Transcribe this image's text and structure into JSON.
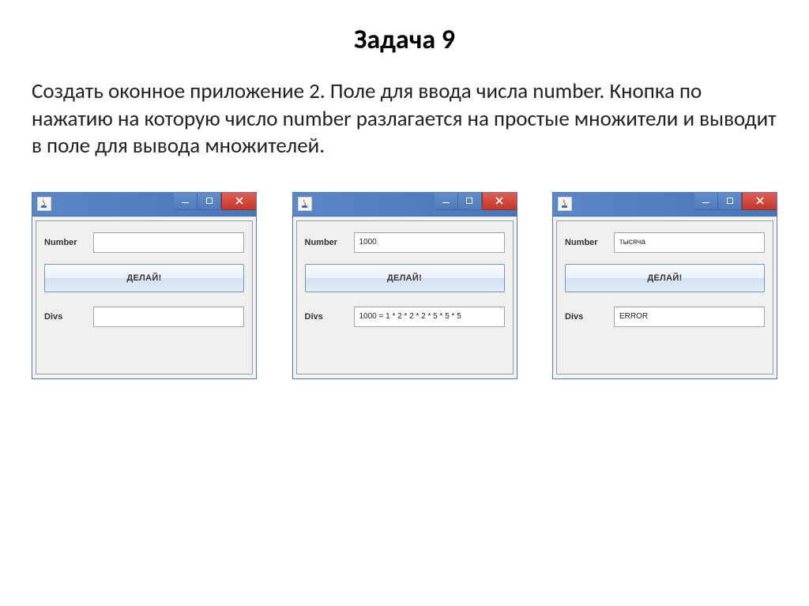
{
  "title": "Задача 9",
  "description": "Создать оконное приложение 2. Поле для ввода числа number. Кнопка по нажатию на которую число number разлагается на простые множители и выводит в поле для вывода множителей.",
  "labels": {
    "number": "Number",
    "divs": "Divs",
    "action": "ДЕЛАЙ!"
  },
  "icons": {
    "app": "java-cup-icon",
    "minimize": "minimize-icon",
    "maximize": "maximize-icon",
    "close": "close-icon"
  },
  "windows": [
    {
      "number_value": "",
      "divs_value": ""
    },
    {
      "number_value": "1000",
      "divs_value": "1000 = 1 * 2 * 2 * 2 * 5 * 5 * 5"
    },
    {
      "number_value": "тысяча",
      "divs_value": "ERROR"
    }
  ]
}
